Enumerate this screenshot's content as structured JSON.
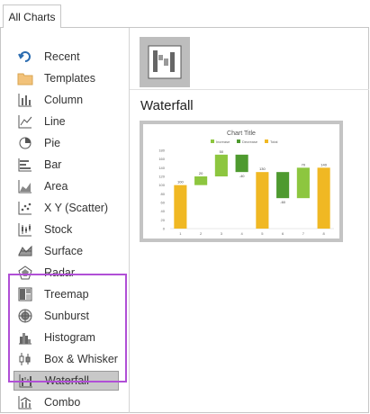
{
  "tab": {
    "label": "All Charts"
  },
  "chart_types": [
    {
      "label": "Recent",
      "icon": "recent-icon"
    },
    {
      "label": "Templates",
      "icon": "folder-icon"
    },
    {
      "label": "Column",
      "icon": "column-chart-icon"
    },
    {
      "label": "Line",
      "icon": "line-chart-icon"
    },
    {
      "label": "Pie",
      "icon": "pie-chart-icon"
    },
    {
      "label": "Bar",
      "icon": "bar-chart-icon"
    },
    {
      "label": "Area",
      "icon": "area-chart-icon"
    },
    {
      "label": "X Y (Scatter)",
      "icon": "scatter-chart-icon"
    },
    {
      "label": "Stock",
      "icon": "stock-chart-icon"
    },
    {
      "label": "Surface",
      "icon": "surface-chart-icon"
    },
    {
      "label": "Radar",
      "icon": "radar-chart-icon"
    },
    {
      "label": "Treemap",
      "icon": "treemap-chart-icon"
    },
    {
      "label": "Sunburst",
      "icon": "sunburst-chart-icon"
    },
    {
      "label": "Histogram",
      "icon": "histogram-chart-icon"
    },
    {
      "label": "Box & Whisker",
      "icon": "box-whisker-chart-icon"
    },
    {
      "label": "Waterfall",
      "icon": "waterfall-chart-icon"
    },
    {
      "label": "Combo",
      "icon": "combo-chart-icon"
    }
  ],
  "selected_index": 15,
  "preview": {
    "heading": "Waterfall"
  },
  "colors": {
    "highlight": "#b04fd6",
    "increase": "#8dc63f",
    "decrease": "#4e9a2f",
    "total": "#f0b823"
  },
  "chart_data": {
    "type": "bar",
    "title": "Chart Title",
    "legend": [
      "Increase",
      "Decrease",
      "Total"
    ],
    "legend_position": "top",
    "categories": [
      "1",
      "2",
      "3",
      "4",
      "5",
      "6",
      "7",
      "8"
    ],
    "values": [
      100,
      20,
      50,
      -40,
      130,
      -60,
      70,
      140
    ],
    "kinds": [
      "total",
      "increase",
      "increase",
      "decrease",
      "total",
      "decrease",
      "increase",
      "total"
    ],
    "y_ticks": [
      "0",
      "20",
      "40",
      "60",
      "80",
      "100",
      "120",
      "140",
      "160",
      "180"
    ],
    "ylim": [
      0,
      180
    ],
    "grid": false
  }
}
